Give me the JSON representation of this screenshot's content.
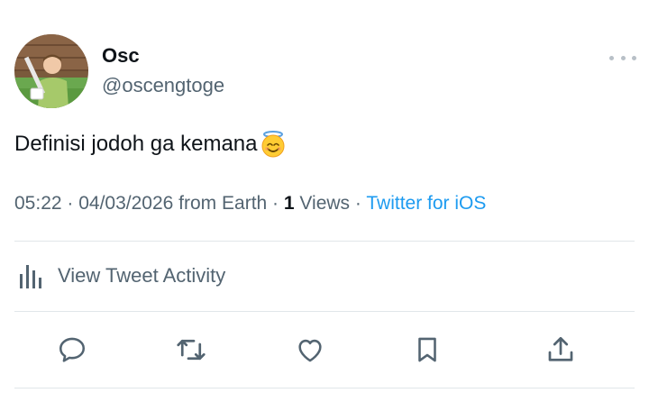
{
  "author": {
    "display_name": "Osc",
    "handle": "@oscengtoge",
    "avatar": "profile-photo"
  },
  "tweet": {
    "text": "Definisi jodoh ga kemana",
    "emoji": "smiling-face-with-halo"
  },
  "meta": {
    "time": "05:22",
    "sep1": " · ",
    "date": "04/03/2026",
    "location": " from Earth",
    "sep2": " · ",
    "views_count": "1",
    "views_label": " Views",
    "sep3": " · ",
    "source": "Twitter for iOS"
  },
  "activity": {
    "label": "View Tweet Activity",
    "icon": "bar-chart-icon"
  },
  "actions": [
    {
      "name": "reply",
      "icon": "reply-icon"
    },
    {
      "name": "retweet",
      "icon": "retweet-icon"
    },
    {
      "name": "like",
      "icon": "heart-icon"
    },
    {
      "name": "bookmark",
      "icon": "bookmark-icon"
    },
    {
      "name": "share",
      "icon": "share-icon"
    }
  ],
  "colors": {
    "text_primary": "#0f1419",
    "text_secondary": "#536471",
    "link": "#1d9bf0",
    "divider": "#e1e6ea"
  }
}
